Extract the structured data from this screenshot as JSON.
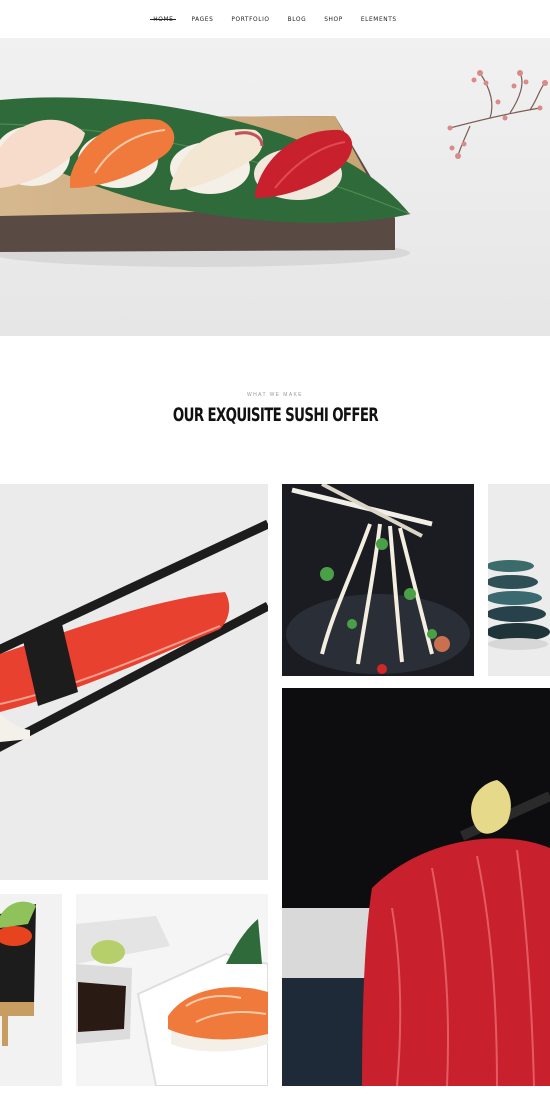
{
  "nav": {
    "items": [
      "Home",
      "Pages",
      "Portfolio",
      "Blog",
      "Shop",
      "Elements"
    ],
    "active_index": 0
  },
  "section": {
    "eyebrow": "What we make",
    "title": "Our exquisite sushi offer"
  },
  "colors": {
    "salmon": "#f07a3c",
    "tuna": "#c8202c",
    "leaf": "#2f6b3a",
    "board": "#c9a77a",
    "nori": "#1c1c1c"
  }
}
